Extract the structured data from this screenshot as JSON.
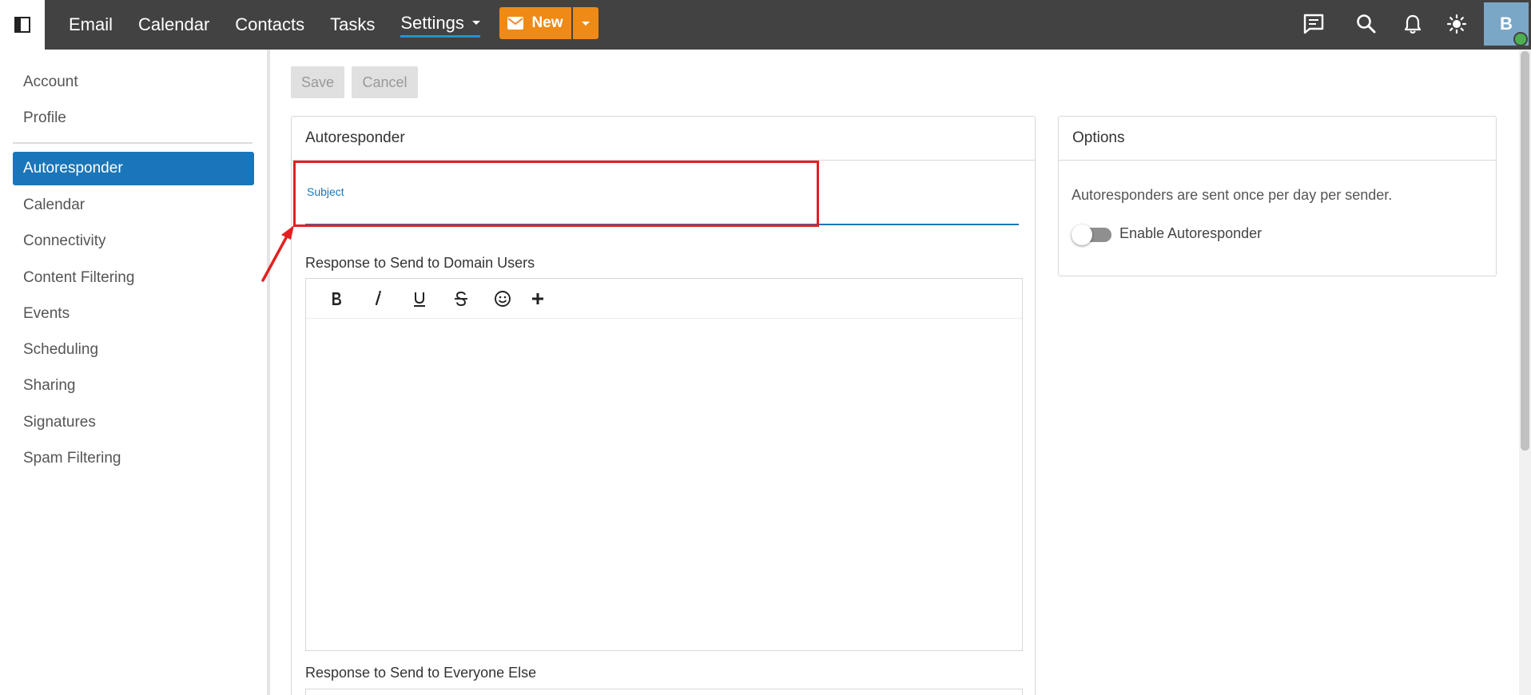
{
  "topbar": {
    "nav": [
      "Email",
      "Calendar",
      "Contacts",
      "Tasks",
      "Settings"
    ],
    "active_nav": "Settings",
    "new_label": "New",
    "avatar_initial": "B",
    "icons": [
      "sidebar-toggle-icon",
      "chat-icon",
      "search-icon",
      "bell-icon",
      "sun-icon"
    ]
  },
  "sidebar": {
    "items": [
      {
        "label": "Account"
      },
      {
        "label": "Profile"
      },
      {
        "label": "Autoresponder",
        "active": true
      },
      {
        "label": "Calendar"
      },
      {
        "label": "Connectivity"
      },
      {
        "label": "Content Filtering"
      },
      {
        "label": "Events"
      },
      {
        "label": "Scheduling"
      },
      {
        "label": "Sharing"
      },
      {
        "label": "Signatures"
      },
      {
        "label": "Spam Filtering"
      }
    ]
  },
  "actions": {
    "save_label": "Save",
    "cancel_label": "Cancel"
  },
  "autoresponder": {
    "title": "Autoresponder",
    "subject_label": "Subject",
    "subject_value": "",
    "domain_label": "Response to Send to Domain Users",
    "everyone_label": "Response to Send to Everyone Else",
    "toolbar": [
      "bold",
      "italic",
      "underline",
      "strikethrough",
      "emoji",
      "insert"
    ]
  },
  "options": {
    "title": "Options",
    "info": "Autoresponders are sent once per day per sender.",
    "toggle_label": "Enable Autoresponder",
    "enabled": false
  },
  "colors": {
    "topbar": "#424242",
    "accent": "#1a76b9",
    "new_button": "#ef8a17",
    "annotation": "#e32020"
  }
}
